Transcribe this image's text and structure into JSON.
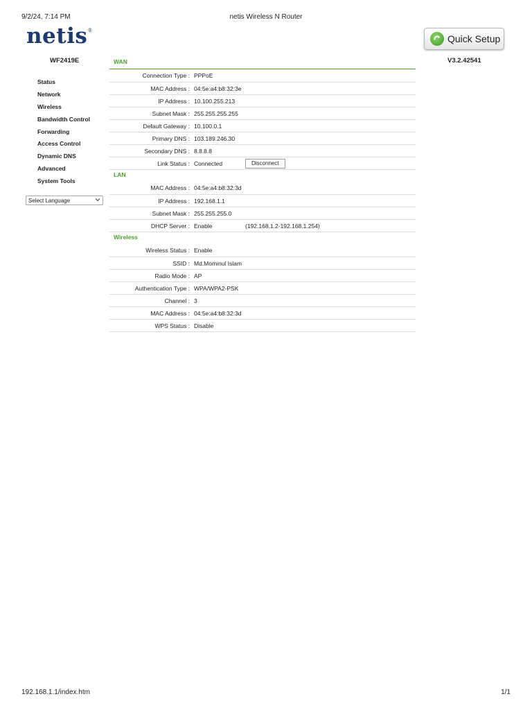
{
  "print": {
    "datetime": "9/2/24, 7:14 PM",
    "title": "netis Wireless N Router",
    "url": "192.168.1.1/index.htm",
    "page": "1/1"
  },
  "header": {
    "logo": "netis",
    "logo_mark": "®",
    "model": "WF2419E",
    "version": "V3.2.42541",
    "quick_setup": "Quick Setup"
  },
  "menu": {
    "items": [
      {
        "label": "Status"
      },
      {
        "label": "Network"
      },
      {
        "label": "Wireless"
      },
      {
        "label": "Bandwidth Control"
      },
      {
        "label": "Forwarding"
      },
      {
        "label": "Access Control"
      },
      {
        "label": "Dynamic DNS"
      },
      {
        "label": "Advanced"
      },
      {
        "label": "System Tools"
      }
    ],
    "language_select": "Select Language"
  },
  "wan": {
    "title": "WAN",
    "connection_type": {
      "label": "Connection Type :",
      "value": "PPPoE"
    },
    "mac": {
      "label": "MAC Address :",
      "value": "04:5e:a4:b8:32:3e"
    },
    "ip": {
      "label": "IP Address :",
      "value": "10.100.255.213"
    },
    "subnet": {
      "label": "Subnet Mask :",
      "value": "255.255.255.255"
    },
    "gateway": {
      "label": "Default Gateway :",
      "value": "10.100.0.1"
    },
    "primary_dns": {
      "label": "Primary DNS :",
      "value": "103.189.246.30"
    },
    "secondary_dns": {
      "label": "Secondary DNS :",
      "value": "8.8.8.8"
    },
    "link_status": {
      "label": "Link Status :",
      "value": "Connected",
      "button": "Disconnect"
    }
  },
  "lan": {
    "title": "LAN",
    "mac": {
      "label": "MAC Address :",
      "value": "04:5e:a4:b8:32:3d"
    },
    "ip": {
      "label": "IP Address :",
      "value": "192.168.1.1"
    },
    "subnet": {
      "label": "Subnet Mask :",
      "value": "255.255.255.0"
    },
    "dhcp": {
      "label": "DHCP Server :",
      "value": "Enable",
      "range": "(192.168.1.2-192.168.1.254)"
    }
  },
  "wireless": {
    "title": "Wireless",
    "status": {
      "label": "Wireless Status :",
      "value": "Enable"
    },
    "ssid": {
      "label": "SSID :",
      "value": "Md.Mominul Islam"
    },
    "radio_mode": {
      "label": "Radio Mode :",
      "value": "AP"
    },
    "auth_type": {
      "label": "Authentication Type :",
      "value": "WPA/WPA2-PSK"
    },
    "channel": {
      "label": "Channel :",
      "value": "3"
    },
    "mac": {
      "label": "MAC Address :",
      "value": "04:5e:a4:b8:32:3d"
    },
    "wps": {
      "label": "WPS Status :",
      "value": "Disable"
    }
  },
  "colors": {
    "accent_green": "#4a9e2f",
    "logo_blue": "#1c3a6e"
  }
}
